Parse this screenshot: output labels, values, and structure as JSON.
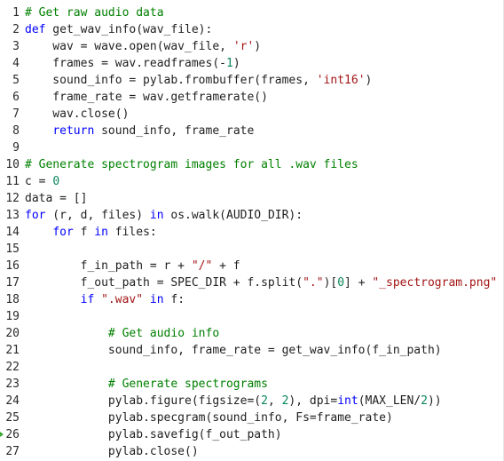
{
  "editor": {
    "lines": [
      {
        "n": "1",
        "t": [
          [
            "com",
            "# Get raw audio data"
          ]
        ]
      },
      {
        "n": "2",
        "t": [
          [
            "kw",
            "def"
          ],
          [
            "p",
            " get_wav_info(wav_file):"
          ]
        ]
      },
      {
        "n": "3",
        "t": [
          [
            "p",
            "    wav = wave.open(wav_file, "
          ],
          [
            "str",
            "'r'"
          ],
          [
            "p",
            ")"
          ]
        ]
      },
      {
        "n": "4",
        "t": [
          [
            "p",
            "    frames = wav.readframes(-"
          ],
          [
            "num",
            "1"
          ],
          [
            "p",
            ")"
          ]
        ]
      },
      {
        "n": "5",
        "t": [
          [
            "p",
            "    sound_info = pylab.frombuffer(frames, "
          ],
          [
            "str",
            "'int16'"
          ],
          [
            "p",
            ")"
          ]
        ]
      },
      {
        "n": "6",
        "t": [
          [
            "p",
            "    frame_rate = wav.getframerate()"
          ]
        ]
      },
      {
        "n": "7",
        "t": [
          [
            "p",
            "    wav.close()"
          ]
        ]
      },
      {
        "n": "8",
        "t": [
          [
            "p",
            "    "
          ],
          [
            "kw",
            "return"
          ],
          [
            "p",
            " sound_info, frame_rate"
          ]
        ]
      },
      {
        "n": "9",
        "t": []
      },
      {
        "n": "10",
        "t": [
          [
            "com",
            "# Generate spectrogram images for all .wav files"
          ]
        ]
      },
      {
        "n": "11",
        "t": [
          [
            "p",
            "c = "
          ],
          [
            "num",
            "0"
          ]
        ]
      },
      {
        "n": "12",
        "t": [
          [
            "p",
            "data = []"
          ]
        ]
      },
      {
        "n": "13",
        "t": [
          [
            "kw",
            "for"
          ],
          [
            "p",
            " (r, d, files) "
          ],
          [
            "kw",
            "in"
          ],
          [
            "p",
            " os.walk(AUDIO_DIR):"
          ]
        ]
      },
      {
        "n": "14",
        "t": [
          [
            "p",
            "    "
          ],
          [
            "kw",
            "for"
          ],
          [
            "p",
            " f "
          ],
          [
            "kw",
            "in"
          ],
          [
            "p",
            " files:"
          ]
        ]
      },
      {
        "n": "15",
        "t": []
      },
      {
        "n": "16",
        "t": [
          [
            "p",
            "        f_in_path = r + "
          ],
          [
            "str",
            "\"/\""
          ],
          [
            "p",
            " + f"
          ]
        ]
      },
      {
        "n": "17",
        "t": [
          [
            "p",
            "        f_out_path = SPEC_DIR + f.split("
          ],
          [
            "str",
            "\".\""
          ],
          [
            "p",
            ")["
          ],
          [
            "num",
            "0"
          ],
          [
            "p",
            "] + "
          ],
          [
            "str",
            "\"_spectrogram.png\""
          ]
        ]
      },
      {
        "n": "18",
        "t": [
          [
            "p",
            "        "
          ],
          [
            "kw",
            "if"
          ],
          [
            "p",
            " "
          ],
          [
            "str",
            "\".wav\""
          ],
          [
            "p",
            " "
          ],
          [
            "kw",
            "in"
          ],
          [
            "p",
            " f:"
          ]
        ]
      },
      {
        "n": "19",
        "t": []
      },
      {
        "n": "20",
        "t": [
          [
            "p",
            "            "
          ],
          [
            "com",
            "# Get audio info"
          ]
        ]
      },
      {
        "n": "21",
        "t": [
          [
            "p",
            "            sound_info, frame_rate = get_wav_info(f_in_path)"
          ]
        ]
      },
      {
        "n": "22",
        "t": []
      },
      {
        "n": "23",
        "t": [
          [
            "p",
            "            "
          ],
          [
            "com",
            "# Generate spectrograms"
          ]
        ]
      },
      {
        "n": "24",
        "t": [
          [
            "p",
            "            pylab.figure(figsize=("
          ],
          [
            "num",
            "2"
          ],
          [
            "p",
            ", "
          ],
          [
            "num",
            "2"
          ],
          [
            "p",
            "), dpi="
          ],
          [
            "kw",
            "int"
          ],
          [
            "p",
            "(MAX_LEN/"
          ],
          [
            "num",
            "2"
          ],
          [
            "p",
            "))"
          ]
        ]
      },
      {
        "n": "25",
        "t": [
          [
            "p",
            "            pylab.specgram(sound_info, Fs=frame_rate)"
          ]
        ]
      },
      {
        "n": "26",
        "t": [
          [
            "p",
            "            pylab.savefig(f_out_path)"
          ]
        ],
        "marker": true
      },
      {
        "n": "27",
        "t": [
          [
            "p",
            "            pylab.close()"
          ]
        ]
      }
    ]
  }
}
